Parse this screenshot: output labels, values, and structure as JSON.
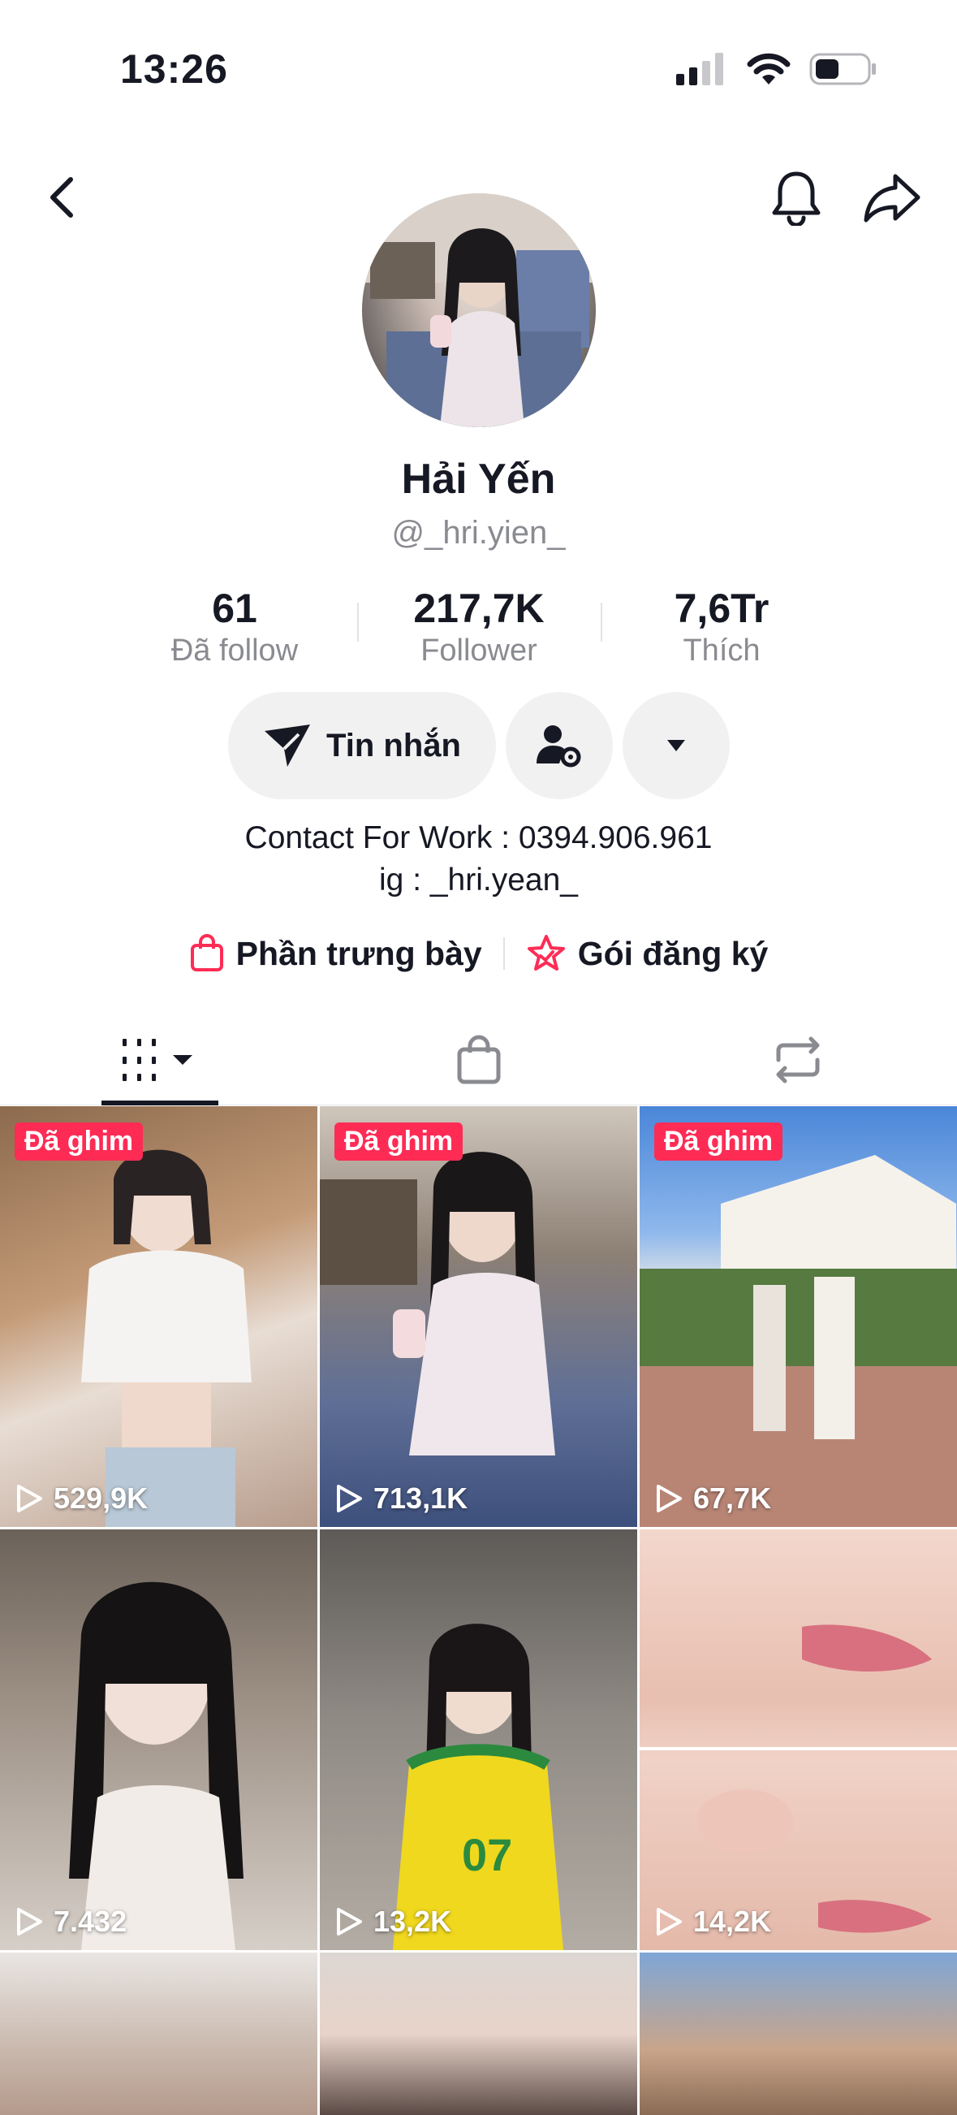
{
  "status_bar": {
    "time": "13:26"
  },
  "profile": {
    "display_name": "Hải Yến",
    "username": "@_hri.yien_",
    "stats": [
      {
        "value": "61",
        "label": "Đã follow"
      },
      {
        "value": "217,7K",
        "label": "Follower"
      },
      {
        "value": "7,6Tr",
        "label": "Thích"
      }
    ],
    "message_button": "Tin nhắn",
    "bio_lines": [
      "Contact For Work : 0394.906.961",
      "ig : _hri.yean_"
    ],
    "links": {
      "showcase": "Phần trưng bày",
      "subscription": "Gói đăng ký"
    }
  },
  "tabs": [
    {
      "name": "videos",
      "active": true
    },
    {
      "name": "shop",
      "active": false
    },
    {
      "name": "reposts",
      "active": false
    }
  ],
  "videos": [
    {
      "pinned_label": "Đã ghim",
      "views": "529,9K"
    },
    {
      "pinned_label": "Đã ghim",
      "views": "713,1K"
    },
    {
      "pinned_label": "Đã ghim",
      "views": "67,7K"
    },
    {
      "pinned_label": "",
      "views": "7.432"
    },
    {
      "pinned_label": "",
      "views": "13,2K"
    },
    {
      "pinned_label": "",
      "views": "14,2K"
    }
  ],
  "colors": {
    "accent": "#fe2c55",
    "text": "#161823",
    "secondary": "#8a8b91",
    "button_bg": "#f1f1f2"
  }
}
